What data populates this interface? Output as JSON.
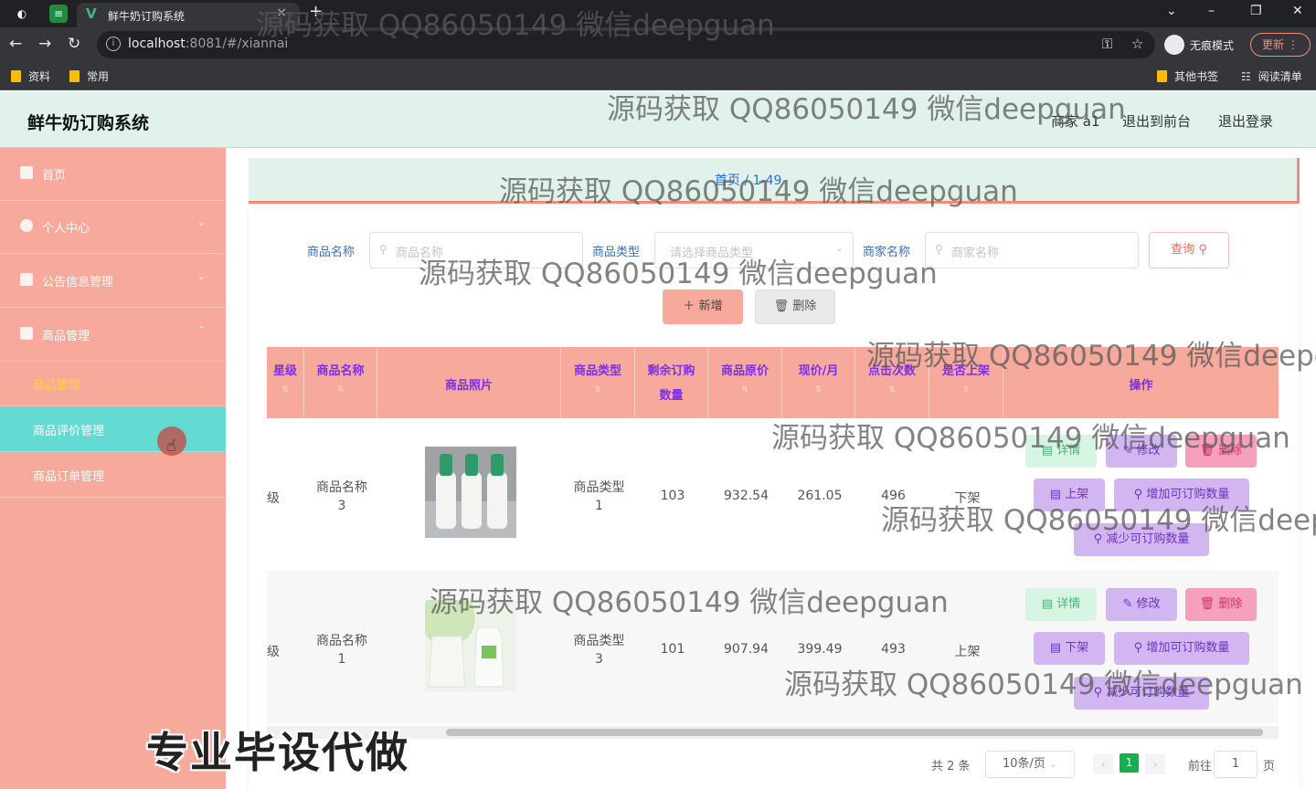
{
  "browser": {
    "tab_title": "鲜牛奶订购系统",
    "url_host": "localhost",
    "url_path": ":8081/#/xiannai",
    "profile_label": "无痕模式",
    "update_label": "更新",
    "bookmarks": [
      "资料",
      "常用"
    ],
    "bookmarks_right": [
      "其他书签",
      "阅读清单"
    ]
  },
  "header": {
    "title": "鲜牛奶订购系统",
    "user": "商家 a1",
    "front_link": "退出到前台",
    "logout_link": "退出登录"
  },
  "sidebar": {
    "items": [
      {
        "label": "首页"
      },
      {
        "label": "个人中心"
      },
      {
        "label": "公告信息管理"
      },
      {
        "label": "商品管理"
      }
    ],
    "sub_items": [
      {
        "label": "商品管理"
      },
      {
        "label": "商品评价管理"
      },
      {
        "label": "商品订单管理"
      }
    ]
  },
  "breadcrumb": "首页 / 1-49",
  "filters": {
    "name_label": "商品名称",
    "name_placeholder": "商品名称",
    "type_label": "商品类型",
    "type_placeholder": "请选择商品类型",
    "merchant_label": "商家名称",
    "merchant_placeholder": "商家名称",
    "query_label": "查询"
  },
  "actions": {
    "add_label": "新增",
    "delete_label": "删除"
  },
  "table": {
    "headers": [
      "星级",
      "商品名称",
      "商品照片",
      "商品类型",
      "剩余订购",
      "数量",
      "商品原价",
      "现价/月",
      "点击次数",
      "是否上架",
      "操作"
    ],
    "rows": [
      {
        "star": "级",
        "name": "商品名称",
        "name_num": "3",
        "type": "商品类型",
        "type_num": "1",
        "remaining": "103",
        "original": "932.54",
        "current": "261.05",
        "clicks": "496",
        "shelf": "下架",
        "shelf_btn": "上架"
      },
      {
        "star": "级",
        "name": "商品名称",
        "name_num": "1",
        "type": "商品类型",
        "type_num": "3",
        "remaining": "101",
        "original": "907.94",
        "current": "399.49",
        "clicks": "493",
        "shelf": "上架",
        "shelf_btn": "下架"
      }
    ],
    "btn_detail": "详情",
    "btn_edit": "修改",
    "btn_delete": "删除",
    "btn_inc": "增加可订购数量",
    "btn_dec": "减少可订购数量"
  },
  "pagination": {
    "total": "共 2 条",
    "size": "10条/页",
    "current": "1",
    "goto": "前往",
    "goto_value": "1",
    "page_unit": "页"
  },
  "overlay_text": "专业毕设代做",
  "watermark": "源码获取 QQ86050149 微信deepguan",
  "colors": {
    "header_bg": "#e0f2ea",
    "sidebar_bg": "#f7a99b",
    "sidebar_active": "#63dad2",
    "table_header_bg": "#f7a99b",
    "header_text": "#7b2ff0",
    "page_active": "#14b04f"
  }
}
